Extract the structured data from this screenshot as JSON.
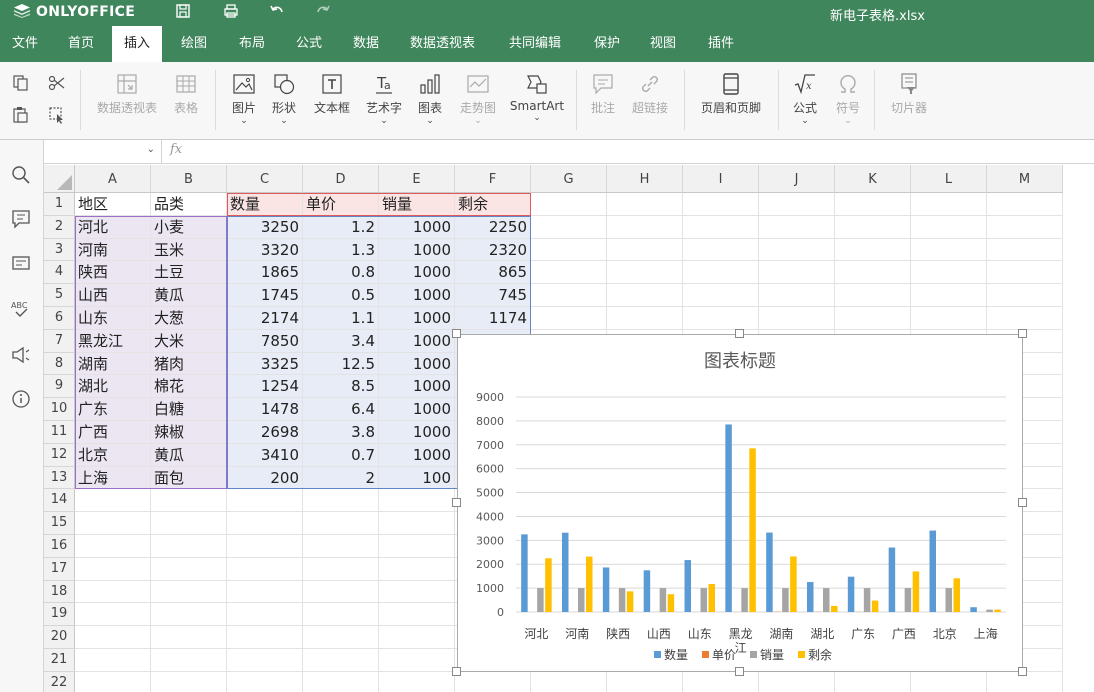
{
  "app": {
    "brand": "ONLYOFFICE",
    "file_name": "新电子表格.xlsx"
  },
  "menu_tabs": [
    {
      "label": "文件"
    },
    {
      "label": "首页"
    },
    {
      "label": "插入",
      "active": true
    },
    {
      "label": "绘图"
    },
    {
      "label": "布局"
    },
    {
      "label": "公式"
    },
    {
      "label": "数据"
    },
    {
      "label": "数据透视表"
    },
    {
      "label": "共同编辑"
    },
    {
      "label": "保护"
    },
    {
      "label": "视图"
    },
    {
      "label": "插件"
    }
  ],
  "ribbon": {
    "pivot_table": "数据透视表",
    "table": "表格",
    "image": "图片",
    "shape": "形状",
    "textbox": "文本框",
    "textart": "艺术字",
    "chart": "图表",
    "sparkline": "走势图",
    "smartart": "SmartArt",
    "comment": "批注",
    "hyperlink": "超链接",
    "header_footer": "页眉和页脚",
    "equation": "公式",
    "symbol": "符号",
    "slicer": "切片器",
    "dropdown_glyph": "⌄"
  },
  "formula_bar": {
    "name_box_value": "",
    "fx_label": "fx",
    "arrow": "⌄"
  },
  "columns": [
    "A",
    "B",
    "C",
    "D",
    "E",
    "F",
    "G",
    "H",
    "I",
    "J",
    "K",
    "L",
    "M"
  ],
  "rows": [
    "1",
    "2",
    "3",
    "4",
    "5",
    "6",
    "7",
    "8",
    "9",
    "10",
    "11",
    "12",
    "13",
    "14",
    "15",
    "16",
    "17",
    "18",
    "19",
    "20",
    "21",
    "22"
  ],
  "table": {
    "header": [
      "地区",
      "品类",
      "数量",
      "单价",
      "销量",
      "剩余"
    ],
    "rows": [
      [
        "河北",
        "小麦",
        "3250",
        "1.2",
        "1000",
        "2250"
      ],
      [
        "河南",
        "玉米",
        "3320",
        "1.3",
        "1000",
        "2320"
      ],
      [
        "陕西",
        "土豆",
        "1865",
        "0.8",
        "1000",
        "865"
      ],
      [
        "山西",
        "黄瓜",
        "1745",
        "0.5",
        "1000",
        "745"
      ],
      [
        "山东",
        "大葱",
        "2174",
        "1.1",
        "1000",
        "1174"
      ],
      [
        "黑龙江",
        "大米",
        "7850",
        "3.4",
        "1000",
        ""
      ],
      [
        "湖南",
        "猪肉",
        "3325",
        "12.5",
        "1000",
        ""
      ],
      [
        "湖北",
        "棉花",
        "1254",
        "8.5",
        "1000",
        ""
      ],
      [
        "广东",
        "白糖",
        "1478",
        "6.4",
        "1000",
        ""
      ],
      [
        "广西",
        "辣椒",
        "2698",
        "3.8",
        "1000",
        ""
      ],
      [
        "北京",
        "黄瓜",
        "3410",
        "0.7",
        "1000",
        ""
      ],
      [
        "上海",
        "面包",
        "200",
        "2",
        "100",
        ""
      ]
    ]
  },
  "colors": {
    "brand_green": "#40865c",
    "series_blue": "#5b9bd5",
    "series_orange": "#ed7d31",
    "series_gray": "#a5a5a5",
    "series_yellow": "#ffc000"
  },
  "chart_data": {
    "type": "bar",
    "title": "图表标题",
    "categories": [
      "河北",
      "河南",
      "陕西",
      "山西",
      "山东",
      "黑龙江",
      "湖南",
      "湖北",
      "广东",
      "广西",
      "北京",
      "上海"
    ],
    "series": [
      {
        "name": "数量",
        "color": "#5b9bd5",
        "values": [
          3250,
          3320,
          1865,
          1745,
          2174,
          7850,
          3325,
          1254,
          1478,
          2698,
          3410,
          200
        ]
      },
      {
        "name": "单价",
        "color": "#ed7d31",
        "values": [
          1.2,
          1.3,
          0.8,
          0.5,
          1.1,
          3.4,
          12.5,
          8.5,
          6.4,
          3.8,
          0.7,
          2
        ]
      },
      {
        "name": "销量",
        "color": "#a5a5a5",
        "values": [
          1000,
          1000,
          1000,
          1000,
          1000,
          1000,
          1000,
          1000,
          1000,
          1000,
          1000,
          100
        ]
      },
      {
        "name": "剩余",
        "color": "#ffc000",
        "values": [
          2250,
          2320,
          865,
          745,
          1174,
          6850,
          2325,
          254,
          478,
          1698,
          1410,
          100
        ]
      }
    ],
    "yticks": [
      "0",
      "1000",
      "2000",
      "3000",
      "4000",
      "5000",
      "6000",
      "7000",
      "8000",
      "9000"
    ],
    "ylim": [
      0,
      9000
    ],
    "grid": true,
    "legend": "bottom"
  }
}
